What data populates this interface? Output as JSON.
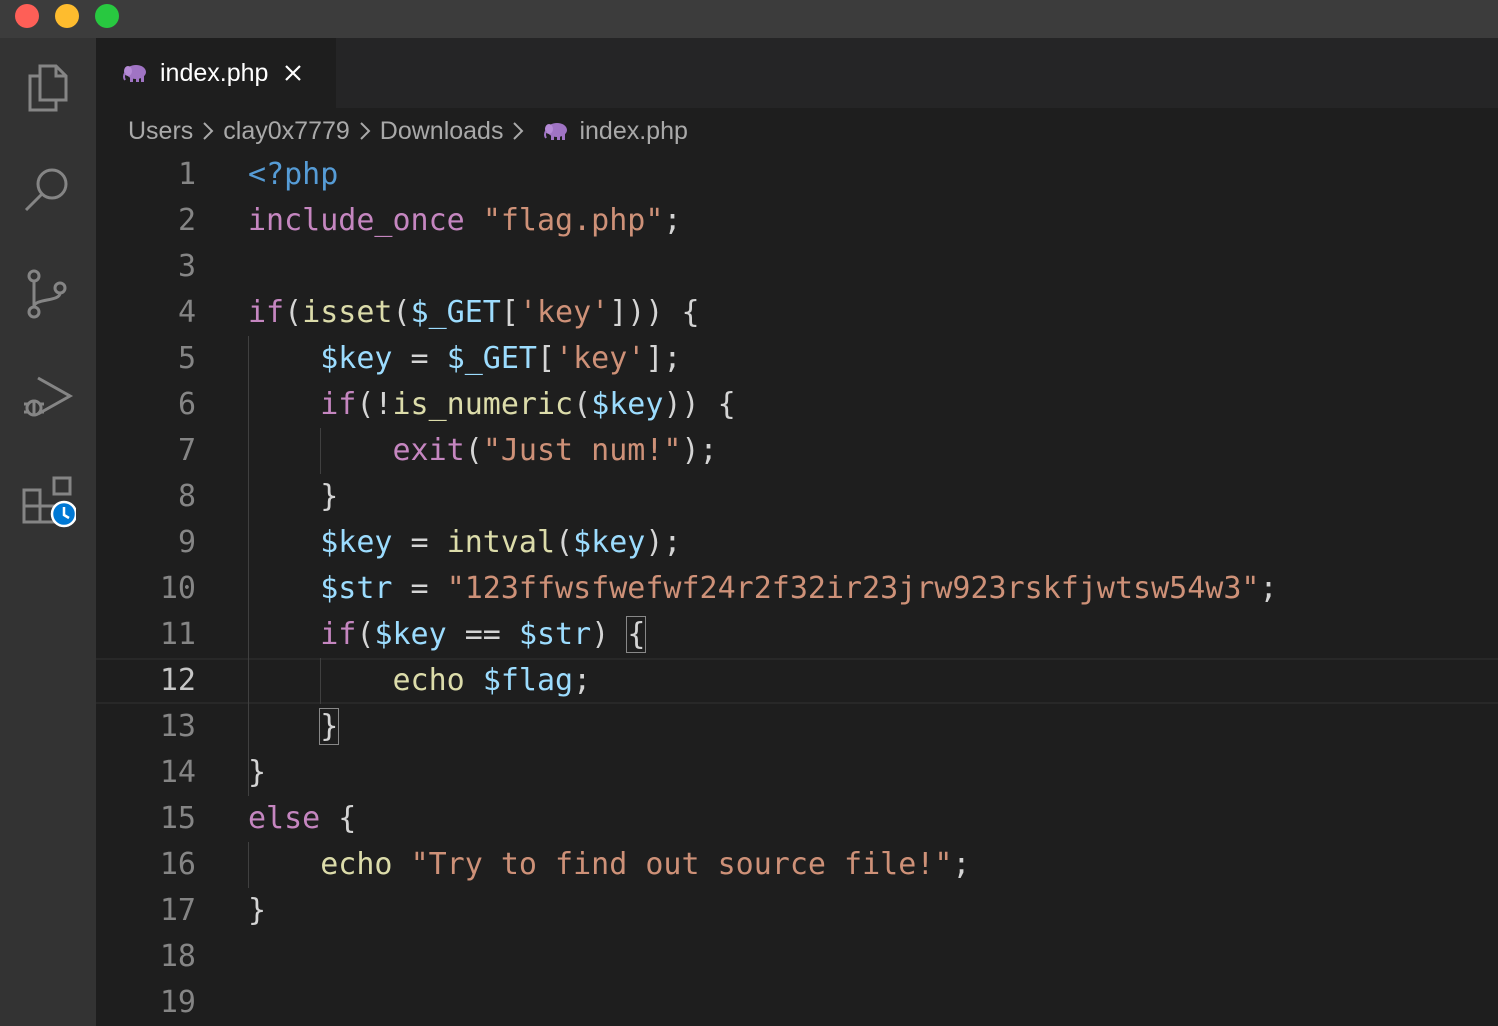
{
  "window": {
    "controls": [
      "close",
      "minimize",
      "maximize"
    ]
  },
  "activity_bar": {
    "items": [
      "files-icon",
      "search-icon",
      "source-control-icon",
      "run-debug-icon",
      "extensions-icon"
    ]
  },
  "tab": {
    "label": "index.php"
  },
  "breadcrumb": {
    "items": [
      "Users",
      "clay0x7779",
      "Downloads",
      "index.php"
    ]
  },
  "editor": {
    "current_line": 12,
    "line_numbers": [
      "1",
      "2",
      "3",
      "4",
      "5",
      "6",
      "7",
      "8",
      "9",
      "10",
      "11",
      "12",
      "13",
      "14",
      "15",
      "16",
      "17",
      "18",
      "19"
    ],
    "lines": [
      [
        {
          "t": "<?php",
          "c": "tag"
        }
      ],
      [
        {
          "t": "include_once",
          "c": "kw"
        },
        {
          "t": " ",
          "c": "op"
        },
        {
          "t": "\"flag.php\"",
          "c": "str"
        },
        {
          "t": ";",
          "c": "op"
        }
      ],
      [],
      [
        {
          "t": "if",
          "c": "kw"
        },
        {
          "t": "(",
          "c": "op"
        },
        {
          "t": "isset",
          "c": "fn"
        },
        {
          "t": "(",
          "c": "op"
        },
        {
          "t": "$_GET",
          "c": "var"
        },
        {
          "t": "[",
          "c": "op"
        },
        {
          "t": "'key'",
          "c": "str"
        },
        {
          "t": "])) {",
          "c": "op"
        }
      ],
      [
        {
          "t": "    ",
          "c": "op"
        },
        {
          "t": "$key",
          "c": "var"
        },
        {
          "t": " = ",
          "c": "op"
        },
        {
          "t": "$_GET",
          "c": "var"
        },
        {
          "t": "[",
          "c": "op"
        },
        {
          "t": "'key'",
          "c": "str"
        },
        {
          "t": "];",
          "c": "op"
        }
      ],
      [
        {
          "t": "    ",
          "c": "op"
        },
        {
          "t": "if",
          "c": "kw"
        },
        {
          "t": "(!",
          "c": "op"
        },
        {
          "t": "is_numeric",
          "c": "fn"
        },
        {
          "t": "(",
          "c": "op"
        },
        {
          "t": "$key",
          "c": "var"
        },
        {
          "t": ")) {",
          "c": "op"
        }
      ],
      [
        {
          "t": "        ",
          "c": "op"
        },
        {
          "t": "exit",
          "c": "kw"
        },
        {
          "t": "(",
          "c": "op"
        },
        {
          "t": "\"Just num!\"",
          "c": "str"
        },
        {
          "t": ");",
          "c": "op"
        }
      ],
      [
        {
          "t": "    }",
          "c": "op"
        }
      ],
      [
        {
          "t": "    ",
          "c": "op"
        },
        {
          "t": "$key",
          "c": "var"
        },
        {
          "t": " = ",
          "c": "op"
        },
        {
          "t": "intval",
          "c": "fn"
        },
        {
          "t": "(",
          "c": "op"
        },
        {
          "t": "$key",
          "c": "var"
        },
        {
          "t": ");",
          "c": "op"
        }
      ],
      [
        {
          "t": "    ",
          "c": "op"
        },
        {
          "t": "$str",
          "c": "var"
        },
        {
          "t": " = ",
          "c": "op"
        },
        {
          "t": "\"123ffwsfwefwf24r2f32ir23jrw923rskfjwtsw54w3\"",
          "c": "str"
        },
        {
          "t": ";",
          "c": "op"
        }
      ],
      [
        {
          "t": "    ",
          "c": "op"
        },
        {
          "t": "if",
          "c": "kw"
        },
        {
          "t": "(",
          "c": "op"
        },
        {
          "t": "$key",
          "c": "var"
        },
        {
          "t": " == ",
          "c": "op"
        },
        {
          "t": "$str",
          "c": "var"
        },
        {
          "t": ") ",
          "c": "op"
        },
        {
          "t": "{",
          "c": "op",
          "m": true
        }
      ],
      [
        {
          "t": "        ",
          "c": "op"
        },
        {
          "t": "echo",
          "c": "fn"
        },
        {
          "t": " ",
          "c": "op"
        },
        {
          "t": "$flag",
          "c": "var"
        },
        {
          "t": ";",
          "c": "op"
        }
      ],
      [
        {
          "t": "    ",
          "c": "op"
        },
        {
          "t": "}",
          "c": "op",
          "m": true
        }
      ],
      [
        {
          "t": "}",
          "c": "op"
        }
      ],
      [
        {
          "t": "else",
          "c": "kw"
        },
        {
          "t": " {",
          "c": "op"
        }
      ],
      [
        {
          "t": "    ",
          "c": "op"
        },
        {
          "t": "echo",
          "c": "fn"
        },
        {
          "t": " ",
          "c": "op"
        },
        {
          "t": "\"Try to find out source file!\"",
          "c": "str"
        },
        {
          "t": ";",
          "c": "op"
        }
      ],
      [
        {
          "t": "}",
          "c": "op"
        }
      ],
      [],
      []
    ]
  }
}
